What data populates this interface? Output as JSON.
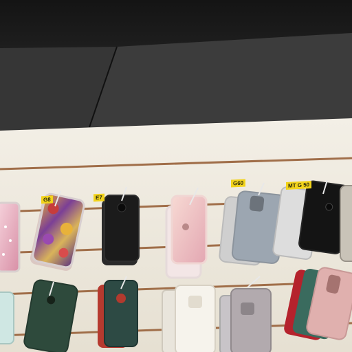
{
  "scene": {
    "description_colors": {
      "ceiling_dark": "#1d1d1d",
      "ceiling_mid": "#3a3a3a",
      "wall": "#efe9dc",
      "slat": "#9b6a45"
    }
  },
  "price_labels": [
    {
      "text": "G8"
    },
    {
      "text": "E7"
    },
    {
      "text": "G60"
    },
    {
      "text": "MT G 50"
    }
  ],
  "phone_cases": [
    {
      "name": "case-pink-glitter",
      "color": "#e8b9c6"
    },
    {
      "name": "case-floral",
      "color": "#8a4aa0"
    },
    {
      "name": "case-black-e7",
      "color": "#1e1e1e"
    },
    {
      "name": "case-rose-transparent",
      "color": "#f1c9c9"
    },
    {
      "name": "case-grey-g60",
      "color": "#9aa3ad"
    },
    {
      "name": "case-black-g50",
      "color": "#151515"
    },
    {
      "name": "case-mint-left",
      "color": "#cfe7e3"
    },
    {
      "name": "case-dark-green",
      "color": "#2f4a3c"
    },
    {
      "name": "case-green-red",
      "color": "#2d4a44"
    },
    {
      "name": "case-white",
      "color": "#f4f1ea"
    },
    {
      "name": "case-grey-lower",
      "color": "#b0a8ad"
    },
    {
      "name": "case-pink-stack",
      "color": "#d9a8a8"
    }
  ]
}
